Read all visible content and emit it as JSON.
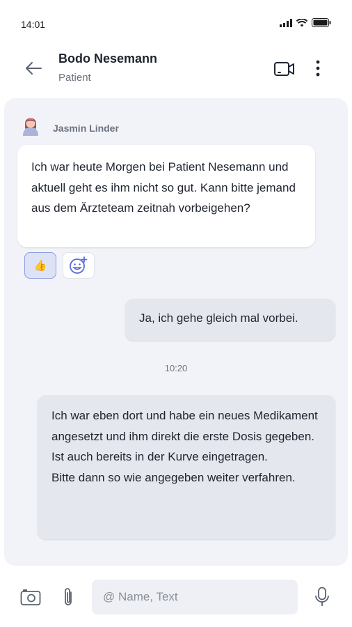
{
  "status_bar": {
    "time": "14:01"
  },
  "header": {
    "title": "Bodo Nesemann",
    "subtitle": "Patient"
  },
  "chat": {
    "sender_name": "Jasmin Linder",
    "messages": [
      {
        "direction": "incoming",
        "text": "Ich war heute Morgen bei Patient Nesemann und aktuell geht es ihm nicht so gut. Kann bitte jemand aus dem Ärzteteam zeitnah vorbeigehen?"
      },
      {
        "direction": "outgoing",
        "text": "Ja, ich gehe gleich mal vorbei."
      },
      {
        "direction": "outgoing",
        "text": "Ich war eben dort und habe ein neues Medikament angesetzt und ihm direkt die erste Dosis gegeben. Ist auch bereits in der Kurve eingetragen.\nBitte dann so wie angegeben weiter verfahren."
      }
    ],
    "reaction": "👍",
    "timestamp": "10:20"
  },
  "composer": {
    "placeholder": "@ Name, Text"
  },
  "colors": {
    "chat_background": "#f2f3f8",
    "reaction_active": "#dde2f6",
    "outgoing_bubble": "#e5e7ee"
  }
}
